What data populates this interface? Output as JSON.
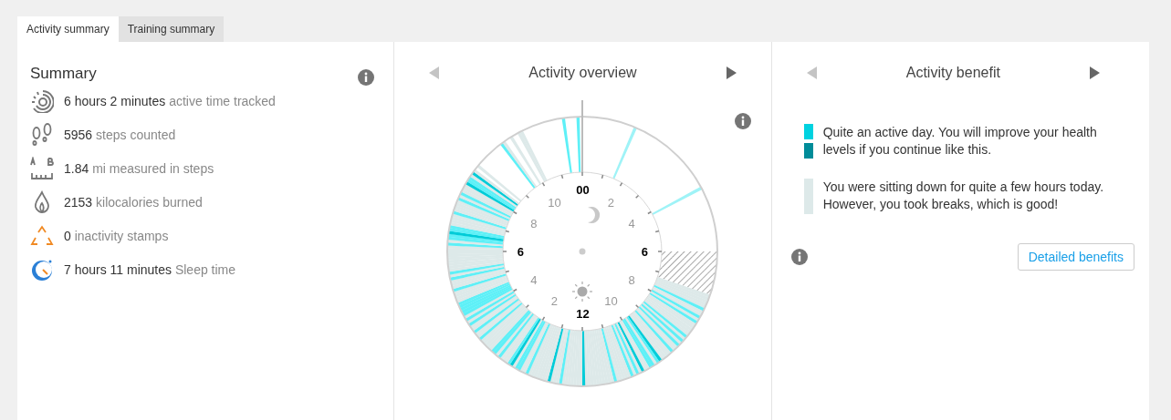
{
  "tabs": [
    {
      "label": "Activity summary",
      "selected": true
    },
    {
      "label": "Training summary",
      "selected": false
    }
  ],
  "summary": {
    "title": "Summary",
    "items": [
      {
        "kind": "active",
        "value": "6 hours 2 minutes",
        "label": "active time tracked"
      },
      {
        "kind": "steps",
        "value": "5956",
        "label": "steps counted"
      },
      {
        "kind": "distance",
        "value": "1.84",
        "label": "mi measured in steps"
      },
      {
        "kind": "calories",
        "value": "2153",
        "label": "kilocalories burned"
      },
      {
        "kind": "inactivity",
        "value": "0",
        "label": "inactivity stamps"
      },
      {
        "kind": "sleep",
        "value": "7 hours 11 minutes",
        "label": "Sleep time"
      }
    ]
  },
  "overview": {
    "title": "Activity overview",
    "prev": {
      "disabled": true
    },
    "next": {
      "disabled": false
    },
    "hour_labels": [
      {
        "text": "00",
        "major": true
      },
      {
        "text": "2",
        "major": false
      },
      {
        "text": "4",
        "major": false
      },
      {
        "text": "6",
        "major": true
      },
      {
        "text": "8",
        "major": false
      },
      {
        "text": "10",
        "major": false
      },
      {
        "text": "12",
        "major": true
      },
      {
        "text": "2",
        "major": false
      },
      {
        "text": "4",
        "major": false
      },
      {
        "text": "6",
        "major": true
      },
      {
        "text": "8",
        "major": false
      },
      {
        "text": "10",
        "major": false
      }
    ]
  },
  "benefit": {
    "title": "Activity benefit",
    "prev": {
      "disabled": true
    },
    "next": {
      "disabled": false
    },
    "legend": [
      {
        "swatches": [
          {
            "color": "#00d2e0"
          },
          {
            "color": "#008c99"
          }
        ],
        "text": "Quite an active day. You will improve your health levels if you continue like this."
      },
      {
        "swatches": [
          {
            "color": "#dde9e9"
          }
        ],
        "text": "You were sitting down for quite a few hours today. However, you took breaks, which is good!"
      }
    ],
    "button": "Detailed benefits"
  }
}
